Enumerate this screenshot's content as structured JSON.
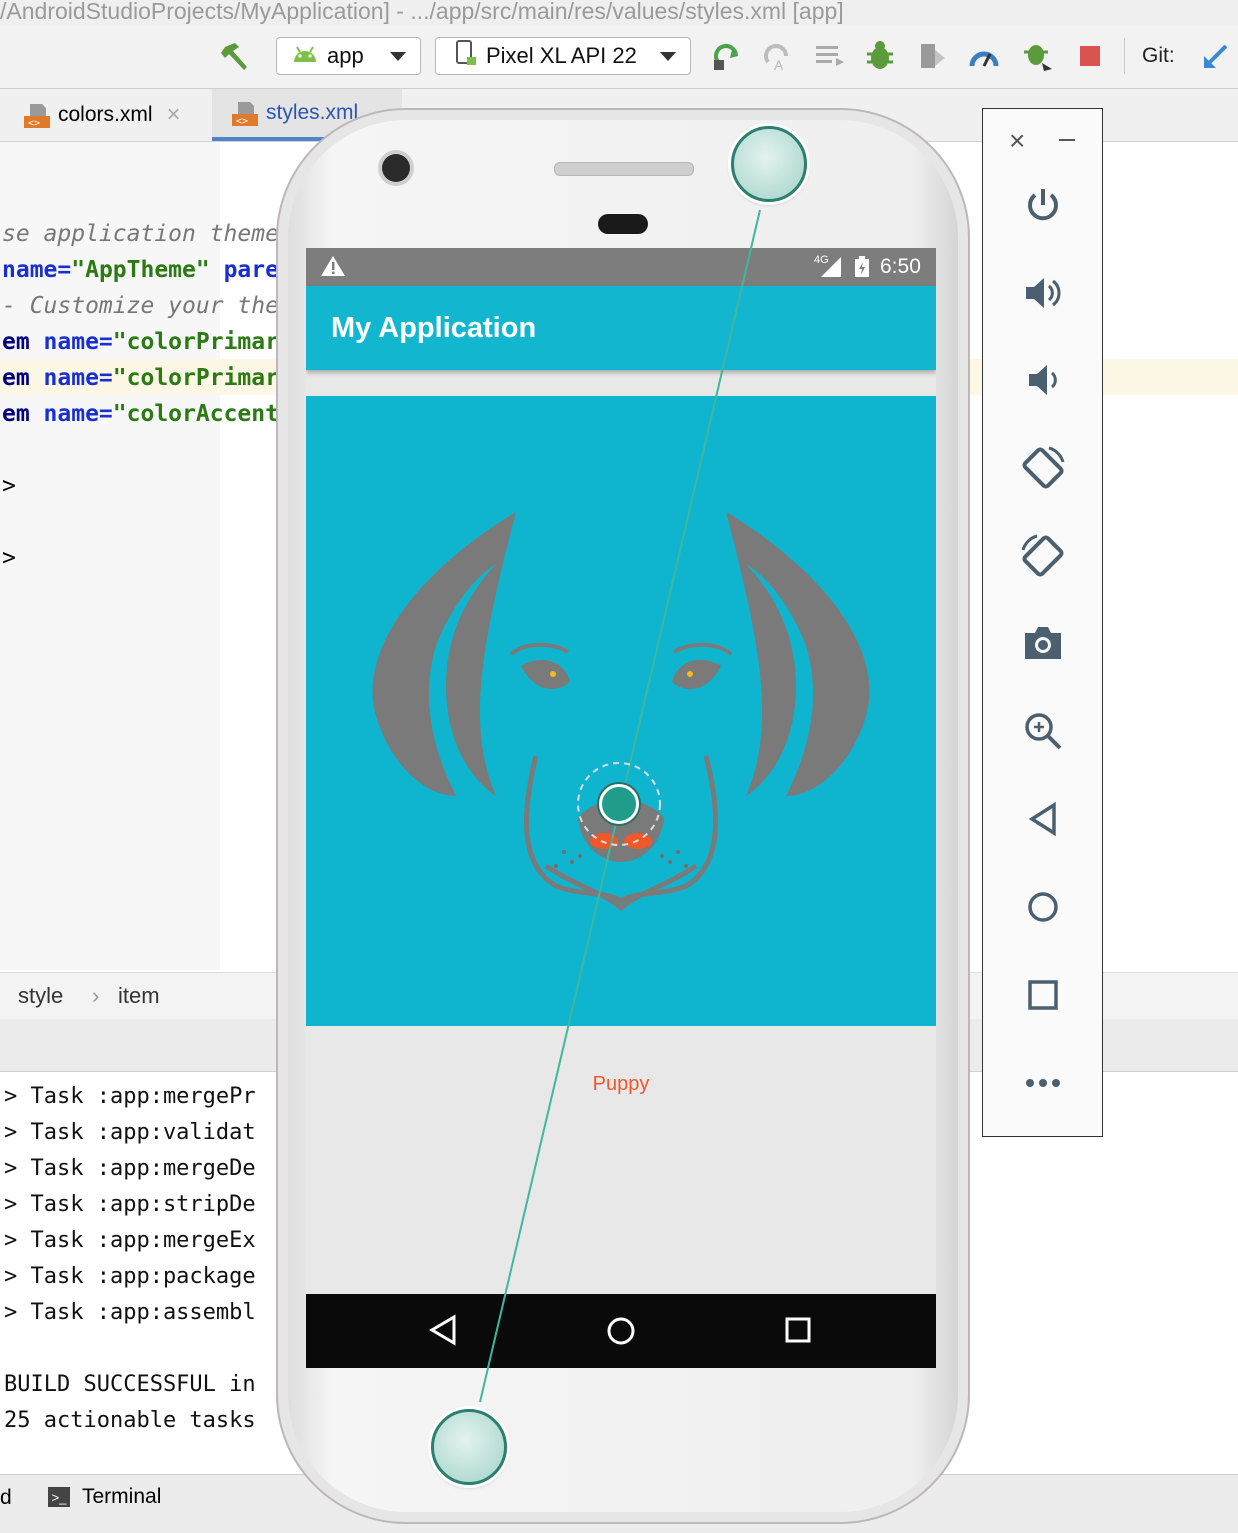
{
  "window": {
    "title": "/AndroidStudioProjects/MyApplication] - .../app/src/main/res/values/styles.xml [app]"
  },
  "toolbar": {
    "run_config": "app",
    "device": "Pixel XL API 22",
    "git_label": "Git:"
  },
  "tabs": [
    {
      "label": "colors.xml",
      "active": false
    },
    {
      "label": "styles.xml",
      "active": true
    }
  ],
  "editor": {
    "lines": [
      {
        "text": "se application theme"
      },
      {
        "a": "name=",
        "b": "\"AppTheme\"",
        "c": " pare"
      },
      {
        "text": "- Customize your the"
      },
      {
        "a": "em ",
        "b": "name=",
        "c": "\"colorPrimar"
      },
      {
        "a": "em ",
        "b": "name=",
        "c": "\"colorPrimar"
      },
      {
        "a": "em ",
        "b": "name=",
        "c": "\"colorAccent"
      },
      {
        "text": ">"
      },
      {
        "text": ">"
      }
    ]
  },
  "breadcrumb": {
    "items": [
      "style",
      "item"
    ]
  },
  "console": {
    "lines": [
      "> Task :app:mergePr",
      "> Task :app:validat",
      "> Task :app:mergeDe",
      "> Task :app:stripDe",
      "> Task :app:mergeEx",
      "> Task :app:package",
      "> Task :app:assembl",
      "",
      "BUILD SUCCESSFUL in",
      "25 actionable tasks"
    ]
  },
  "bottom_bar": {
    "left_fragment": "d",
    "terminal_label": "Terminal"
  },
  "emulator": {
    "status_bar": {
      "network": "4G",
      "time": "6:50"
    },
    "app_title": "My Application",
    "image_caption": "Puppy",
    "colors": {
      "primary": "#12b7cf",
      "status_bar": "#7d7d7d",
      "caption": "#f0572a"
    },
    "side_controls": [
      "close-icon",
      "minimize-icon",
      "power-icon",
      "volume-up-icon",
      "volume-down-icon",
      "rotate-left-icon",
      "rotate-right-icon",
      "camera-icon",
      "zoom-icon",
      "back-icon",
      "home-icon",
      "overview-icon",
      "more-icon"
    ]
  }
}
